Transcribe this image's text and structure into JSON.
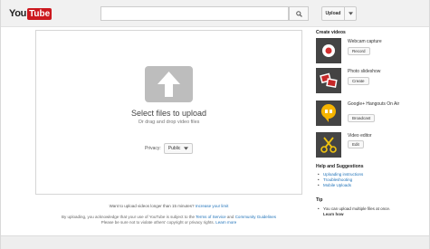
{
  "header": {
    "logo_you": "You",
    "logo_tube": "Tube",
    "search_placeholder": "",
    "upload_label": "Upload"
  },
  "upload": {
    "select_files": "Select files to upload",
    "drag_drop": "Or drag and drop video files",
    "privacy_label": "Privacy:",
    "privacy_value": "Public",
    "longer_prefix": "Want to upload videos longer than 15 minutes?",
    "longer_link": "Increase your limit",
    "legal_1": "By uploading, you acknowledge that your use of YouTube is subject to the",
    "legal_tos": "Terms of Service",
    "legal_and": "and",
    "legal_guidelines": "Community Guidelines",
    "legal_2": "Please be sure not to violate others' copyright or privacy rights.",
    "legal_learn": "Learn more"
  },
  "sidebar": {
    "create_heading": "Create videos",
    "items": [
      {
        "title": "Webcam capture",
        "button": "Record",
        "icon": "webcam-icon",
        "color": "#d32f2f"
      },
      {
        "title": "Photo slideshow",
        "button": "Create",
        "icon": "photos-icon",
        "color": "#c62828"
      },
      {
        "title": "Google+ Hangouts On Air",
        "button": "Broadcast",
        "icon": "hangouts-icon",
        "color": "#f6b400"
      },
      {
        "title": "Video editor",
        "button": "Edit",
        "icon": "scissors-icon",
        "color": "#f1c40f"
      }
    ],
    "help_heading": "Help and Suggestions",
    "help_links": [
      "Uploading instructions",
      "Troubleshooting",
      "Mobile Uploads"
    ],
    "tip_heading": "Tip",
    "tip_text": "You can upload multiple files at once.",
    "tip_link": "Learn how"
  },
  "colors": {
    "brand_red": "#cc181e",
    "link_blue": "#1e71b8",
    "thumb_dark": "#444444"
  }
}
